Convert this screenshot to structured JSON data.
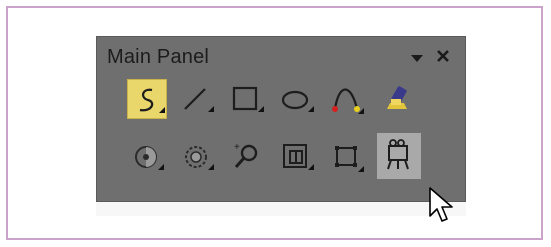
{
  "panel": {
    "title": "Main Panel",
    "menu_icon": "dropdown-arrow-icon",
    "close_icon": "close-icon"
  },
  "toolbar_rows": [
    [
      {
        "name": "freehand-select-tool",
        "icon": "freehand-lasso-icon",
        "state": "active"
      },
      {
        "name": "line-tool",
        "icon": "line-icon",
        "state": "normal"
      },
      {
        "name": "rectangle-tool",
        "icon": "rectangle-icon",
        "state": "normal"
      },
      {
        "name": "ellipse-tool",
        "icon": "ellipse-icon",
        "state": "normal"
      },
      {
        "name": "curve-tool",
        "icon": "bezier-curve-icon",
        "state": "normal"
      },
      {
        "name": "paint-tool",
        "icon": "paint-bucket-icon",
        "state": "normal"
      }
    ],
    [
      {
        "name": "color-tool",
        "icon": "color-mask-icon",
        "state": "normal"
      },
      {
        "name": "adjust-tool",
        "icon": "adjust-mask-icon",
        "state": "normal"
      },
      {
        "name": "zoom-tool",
        "icon": "zoom-icon",
        "state": "normal"
      },
      {
        "name": "crop-tool",
        "icon": "crop-icon",
        "state": "normal"
      },
      {
        "name": "transform-tool",
        "icon": "transform-icon",
        "state": "normal"
      },
      {
        "name": "camera-tool",
        "icon": "camera-icon",
        "state": "hover"
      }
    ]
  ],
  "colors": {
    "panel_bg": "#6f6f6f",
    "active_bg": "#e9d76b",
    "hover_bg": "#a9a9a9",
    "frame_border": "#c9a3c9"
  }
}
